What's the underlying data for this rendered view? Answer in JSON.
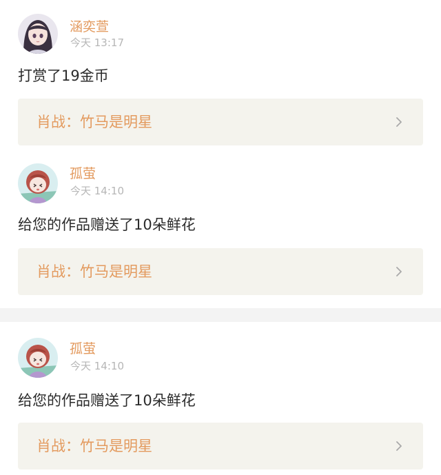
{
  "feed": [
    {
      "user": "涵奕萱",
      "time": "今天 13:17",
      "message": "打赏了19金币",
      "work": "肖战：竹马是明星",
      "avatar": "girl-avatar"
    },
    {
      "user": "孤萤",
      "time": "今天 14:10",
      "message": "给您的作品赠送了10朵鲜花",
      "work": "肖战：竹马是明星",
      "avatar": "anime-avatar"
    },
    {
      "user": "孤萤",
      "time": "今天 14:10",
      "message": "给您的作品赠送了10朵鲜花",
      "work": "肖战：竹马是明星",
      "avatar": "anime-avatar"
    }
  ],
  "colors": {
    "accent": "#e39a5e",
    "card_bg": "#f4f3ed",
    "divider": "#f3f3f3",
    "time": "#b6b6b6",
    "text": "#2b2b2b"
  }
}
